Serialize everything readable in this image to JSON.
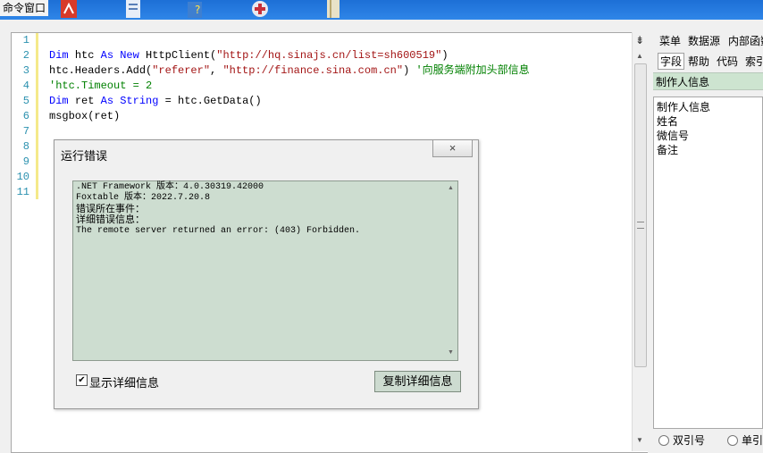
{
  "window": {
    "title": "命令窗口"
  },
  "toolbar": {
    "icons": [
      "pdf-icon",
      "document-icon",
      "help-icon",
      "tool-icon",
      "book-icon"
    ]
  },
  "editor": {
    "line_numbers": [
      "1",
      "2",
      "3",
      "4",
      "5",
      "6",
      "7",
      "8",
      "9",
      "10",
      "11"
    ],
    "lines": [
      [],
      [
        {
          "t": "Dim ",
          "c": "kw"
        },
        {
          "t": "htc ",
          "c": ""
        },
        {
          "t": "As ",
          "c": "kw"
        },
        {
          "t": "New ",
          "c": "kw"
        },
        {
          "t": "HttpClient(",
          "c": ""
        },
        {
          "t": "\"http://hq.sinajs.cn/list=sh600519\"",
          "c": "str"
        },
        {
          "t": ")",
          "c": ""
        }
      ],
      [
        {
          "t": "htc.Headers.Add(",
          "c": ""
        },
        {
          "t": "\"referer\"",
          "c": "str"
        },
        {
          "t": ", ",
          "c": ""
        },
        {
          "t": "\"http://finance.sina.com.cn\"",
          "c": "str"
        },
        {
          "t": ") ",
          "c": ""
        },
        {
          "t": "'向服务端附加头部信息",
          "c": "cm"
        }
      ],
      [
        {
          "t": "'htc.Timeout = 2",
          "c": "cm"
        }
      ],
      [
        {
          "t": "Dim ",
          "c": "kw"
        },
        {
          "t": "ret ",
          "c": ""
        },
        {
          "t": "As ",
          "c": "kw"
        },
        {
          "t": "String ",
          "c": "kw"
        },
        {
          "t": "= htc.GetData()",
          "c": ""
        }
      ],
      [
        {
          "t": "msgbox(ret)",
          "c": ""
        }
      ],
      [],
      [],
      [],
      [],
      []
    ]
  },
  "dialog": {
    "title": "运行错误",
    "close_label": "×",
    "text_lines": [
      ".NET Framework 版本：4.0.30319.42000",
      "Foxtable 版本：2022.7.20.8",
      "错误所在事件：",
      "详细错误信息：",
      "The remote server returned an error: (403) Forbidden."
    ],
    "checkbox_label": "显示详细信息",
    "checkbox_checked": true,
    "copy_button": "复制详细信息"
  },
  "right_panel": {
    "tabs_row1": [
      "菜单",
      "数据源",
      "内部函数"
    ],
    "tabs_row2": [
      "字段",
      "帮助",
      "代码",
      "索引"
    ],
    "header": "制作人信息",
    "items": [
      "制作人信息",
      "姓名",
      "微信号",
      "备注"
    ],
    "radio_double": "双引号",
    "radio_single": "单引号"
  }
}
